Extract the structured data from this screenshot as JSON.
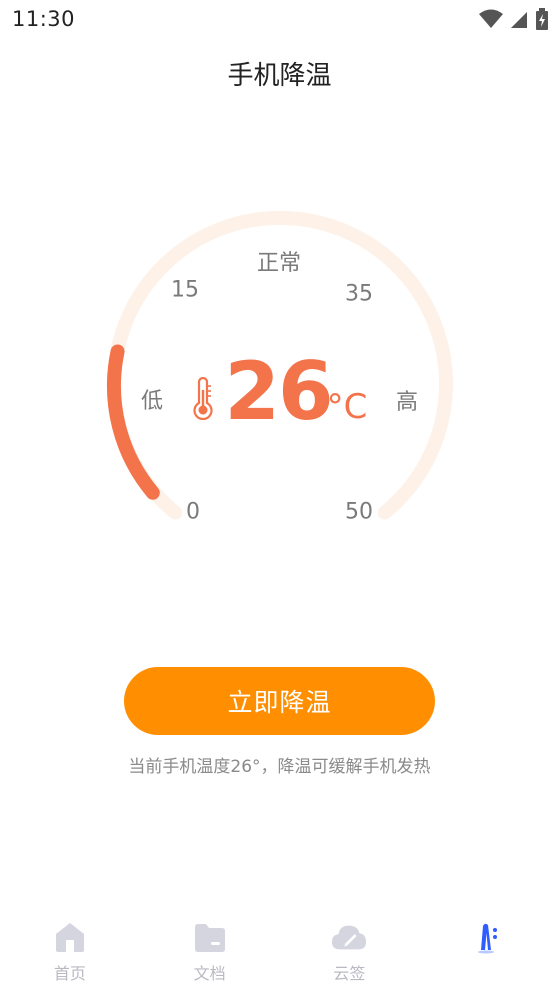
{
  "status_bar": {
    "time": "11:30"
  },
  "header": {
    "title": "手机降温"
  },
  "gauge": {
    "status_label": "正常",
    "tick_0": "0",
    "tick_15": "15",
    "tick_35": "35",
    "tick_50": "50",
    "low_label": "低",
    "high_label": "高",
    "temperature": "26",
    "unit": "°C",
    "level_fraction": 0.2,
    "colors": {
      "track": "#fdf1e8",
      "active": "#f3734a"
    }
  },
  "action": {
    "button_label": "立即降温",
    "hint": "当前手机温度26°，降温可缓解手机发热"
  },
  "bottom_nav": {
    "items": [
      {
        "label": "首页",
        "icon": "home-icon"
      },
      {
        "label": "文档",
        "icon": "folder-icon"
      },
      {
        "label": "云签",
        "icon": "cloud-sign-icon"
      },
      {
        "label": "",
        "icon": "cooling-icon"
      }
    ]
  },
  "colors": {
    "accent": "#ff8f00",
    "nav_inactive": "#d5d5e0",
    "nav_active": "#2f5dff"
  }
}
